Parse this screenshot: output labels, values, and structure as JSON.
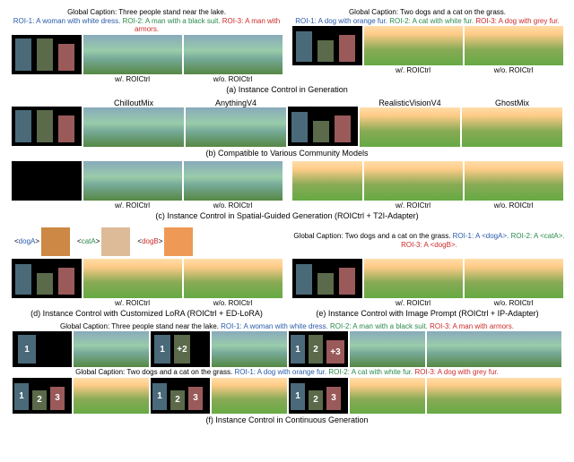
{
  "sectionA": {
    "left": {
      "global": "Global Caption: Three people stand near the lake.",
      "roi1": "ROI-1: A woman with white dress.",
      "roi2": "ROI-2: A man with a black suit.",
      "roi3": "ROI-3: A man with armors."
    },
    "right": {
      "global": "Global Caption: Two dogs and a cat on the grass.",
      "roi1": "ROI-1: A dog with orange fur.",
      "roi2": "ROI-2: A cat with white fur.",
      "roi3": "ROI-3: A dog with grey fur."
    },
    "with": "w/. ROICtrl",
    "without": "w/o. ROICtrl",
    "label": "(a) Instance Control in Generation"
  },
  "sectionB": {
    "models": [
      "ChilloutMix",
      "AnythingV4",
      "RealisticVisionV4",
      "GhostMix"
    ],
    "label": "(b) Compatible to Various Community Models"
  },
  "sectionC": {
    "with": "w/. ROICtrl",
    "without": "w/o. ROICtrl",
    "label": "(c) Instance Control in Spatial-Guided Generation (ROICtrl + T2I-Adapter)"
  },
  "sectionD": {
    "concepts": {
      "dogA": "dogA",
      "catA": "catA",
      "dogB": "dogB"
    },
    "global": "Global Caption: Two dogs and a cat on the grass.",
    "roi1": "ROI-1: A <dogA>.",
    "roi2": "ROI-2: A <catA>.",
    "roi3": "ROI-3: A <dogB>.",
    "with": "w/. ROICtrl",
    "without": "w/o. ROICtrl",
    "labelD": "(d) Instance Control with Customized LoRA (ROICtrl + ED-LoRA)",
    "labelE": "(e) Instance Control with Image Prompt (ROICtrl + IP-Adapter)"
  },
  "sectionF": {
    "cap1_global": "Global Caption: Three people stand near the lake.",
    "cap1_roi1": "ROI-1: A woman with white dress.",
    "cap1_roi2": "ROI-2: A man with a black suit.",
    "cap1_roi3": "ROI-3: A man with armors.",
    "cap2_global": "Global Caption: Two dogs and a cat on the grass.",
    "cap2_roi1": "ROI-1: A dog with orange fur.",
    "cap2_roi2": "ROI-2: A cat with white fur.",
    "cap2_roi3": "ROI-3: A dog with grey fur.",
    "label": "(f) Instance Control in Continuous Generation",
    "nums": {
      "n1": "1",
      "n2": "2",
      "n3": "3",
      "p2": "+2",
      "p3": "+3"
    }
  }
}
